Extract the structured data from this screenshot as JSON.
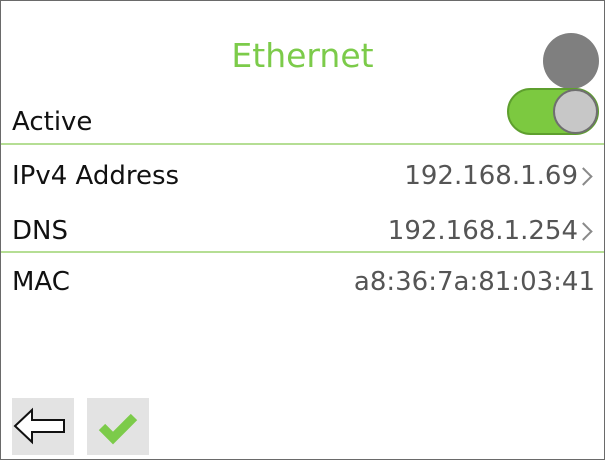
{
  "header": {
    "title": "Ethernet",
    "status_indicator_color": "#7f7f7f"
  },
  "active": {
    "label": "Active",
    "enabled": true,
    "toggle_color": "#7cc940"
  },
  "rows": [
    {
      "label": "IPv4 Address",
      "value": "192.168.1.69",
      "has_chevron": true
    },
    {
      "label": "DNS",
      "value": "192.168.1.254",
      "has_chevron": true
    },
    {
      "label": "MAC",
      "value": "a8:36:7a:81:03:41",
      "has_chevron": false
    }
  ],
  "footer": {
    "back_icon": "left-arrow-icon",
    "confirm_icon": "checkmark-icon",
    "accent_color": "#7ccb4a"
  }
}
